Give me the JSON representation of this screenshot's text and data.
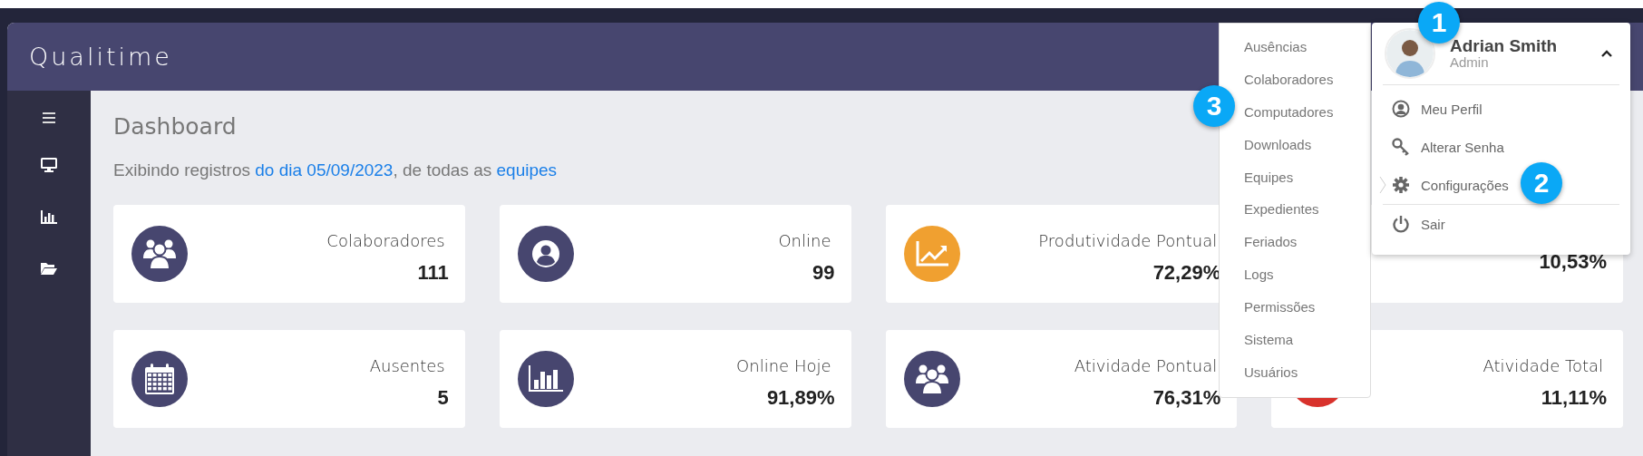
{
  "header": {
    "logo": "Qualitime"
  },
  "page": {
    "title": "Dashboard",
    "subtitle": [
      {
        "text": "Exibindo registros ",
        "link": false
      },
      {
        "text": "do dia 05/09/2023",
        "link": true
      },
      {
        "text": ", de todas as ",
        "link": false
      },
      {
        "text": "equipes",
        "link": true
      }
    ]
  },
  "cards": [
    {
      "label": "Colaboradores",
      "value": "111",
      "kind": "group",
      "color": "#47466f"
    },
    {
      "label": "Online",
      "value": "99",
      "kind": "user",
      "color": "#47466f"
    },
    {
      "label": "Produtividade Pontual",
      "value": "72,29%",
      "kind": "trend",
      "color": "#f0a030"
    },
    {
      "value": "10,53%"
    },
    {
      "label": "Ausentes",
      "value": "5",
      "kind": "calendar",
      "color": "#47466f"
    },
    {
      "label": "Online Hoje",
      "value": "91,89%",
      "kind": "bars",
      "color": "#47466f"
    },
    {
      "label": "Atividade Pontual",
      "value": "76,31%",
      "kind": "group",
      "color": "#47466f"
    },
    {
      "label": "Atividade Total",
      "value": "11,11%",
      "kind": "plain",
      "color": "#d8322c"
    }
  ],
  "submenu": [
    "Ausências",
    "Colaboradores",
    "Computadores",
    "Downloads",
    "Equipes",
    "Expedientes",
    "Feriados",
    "Logs",
    "Permissões",
    "Sistema",
    "Usuários"
  ],
  "user_menu": {
    "name": "Adrian Smith",
    "role": "Admin",
    "expanded": true,
    "items": [
      {
        "label": "Meu Perfil",
        "kind": "user"
      },
      {
        "label": "Alterar Senha",
        "kind": "key"
      },
      {
        "label": "Configurações",
        "kind": "gear"
      },
      {
        "label": "Sair",
        "kind": "power"
      }
    ]
  },
  "callouts": [
    "1",
    "2",
    "3"
  ]
}
